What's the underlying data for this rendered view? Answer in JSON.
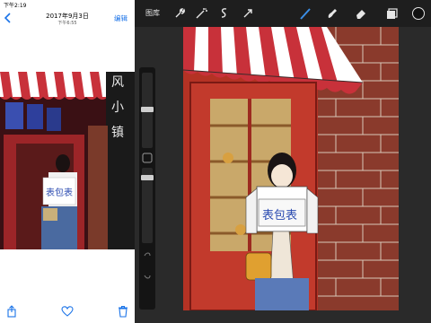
{
  "status": {
    "time": "下午2:19"
  },
  "photos": {
    "date": "2017年9月3日",
    "time": "下午6:55",
    "edit_label": "编辑",
    "photo_sign_text": "表包表",
    "photo_shop_text": "风小镇"
  },
  "procreate": {
    "gallery_label": "图库",
    "canvas_sign_text": "表包表"
  },
  "colors": {
    "accent": "#1a73e8",
    "procreate_brush_active": "#3a8ee6",
    "storefront_red": "#b43224",
    "awning_red": "#c8313a"
  },
  "icons": [
    "back-icon",
    "share-icon",
    "heart-icon",
    "trash-icon",
    "wrench-icon",
    "magic-wand-icon",
    "selection-icon",
    "move-icon",
    "brush-icon",
    "smudge-icon",
    "eraser-icon",
    "layers-icon",
    "color-icon"
  ]
}
